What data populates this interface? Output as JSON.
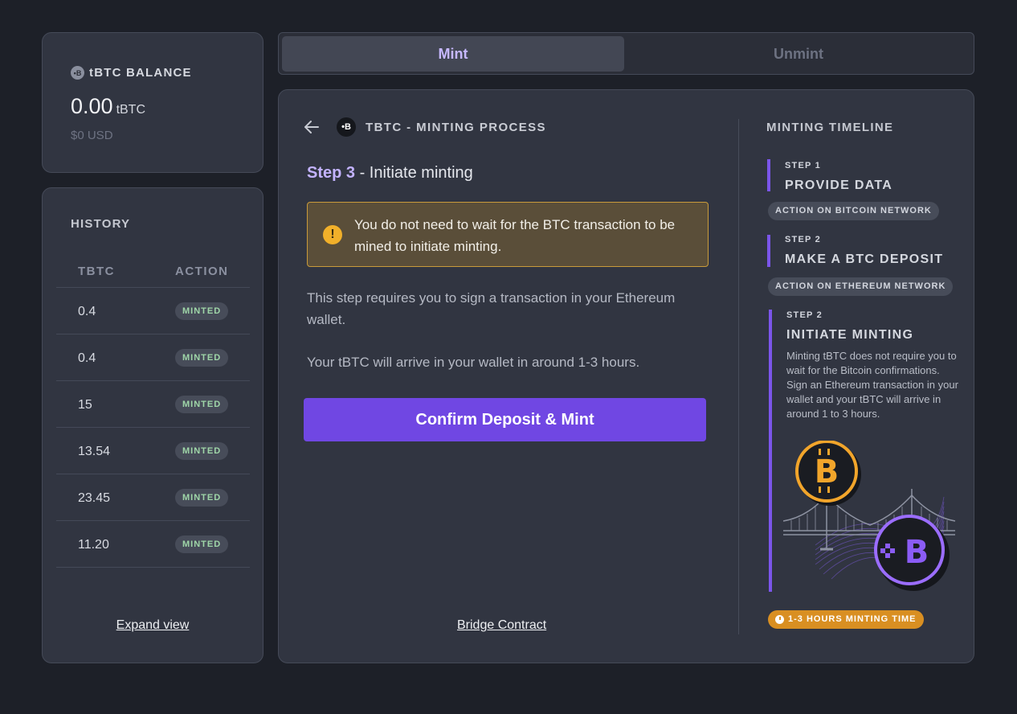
{
  "balance": {
    "title": "tBTC BALANCE",
    "badge_glyph": "•B",
    "amount": "0.00",
    "unit": "tBTC",
    "usd": "$0 USD"
  },
  "history": {
    "title": "HISTORY",
    "columns": [
      "TBTC",
      "ACTION"
    ],
    "rows": [
      {
        "amount": "0.4",
        "action": "MINTED"
      },
      {
        "amount": "0.4",
        "action": "MINTED"
      },
      {
        "amount": "15",
        "action": "MINTED"
      },
      {
        "amount": "13.54",
        "action": "MINTED"
      },
      {
        "amount": "23.45",
        "action": "MINTED"
      },
      {
        "amount": "11.20",
        "action": "MINTED"
      }
    ],
    "expand_label": "Expand view"
  },
  "tabs": [
    {
      "label": "Mint",
      "active": true
    },
    {
      "label": "Unmint",
      "active": false
    }
  ],
  "main": {
    "title": "TBTC - MINTING PROCESS",
    "logo_glyph": "•B",
    "step_number": "Step 3",
    "step_title": " - Initiate minting",
    "warning_icon": "!",
    "warning_text": "You do not need to wait for the BTC transaction to be mined to initiate minting.",
    "paragraph_1": "This step requires you to sign a transaction in your Ethereum wallet.",
    "paragraph_2": "Your tBTC will arrive in your wallet in around 1-3 hours.",
    "confirm_label": "Confirm Deposit & Mint",
    "bridge_link": "Bridge Contract"
  },
  "timeline": {
    "title": "MINTING TIMELINE",
    "steps": [
      {
        "label": "STEP 1",
        "title": "PROVIDE DATA",
        "badge": "ACTION ON BITCOIN NETWORK"
      },
      {
        "label": "STEP 2",
        "title": "MAKE A BTC DEPOSIT",
        "badge": "ACTION ON ETHEREUM NETWORK"
      },
      {
        "label": "STEP 2",
        "title": "INITIATE MINTING",
        "description_1": "Minting tBTC does not require you to wait for the Bitcoin confirmations.",
        "description_2": "Sign an Ethereum transaction in your wallet and your tBTC will arrive in around 1 to 3 hours."
      }
    ],
    "time_badge": "1-3 HOURS MINTING TIME"
  },
  "colors": {
    "background": "#1d2028",
    "card": "#313541",
    "accent": "#7047e3",
    "accent_text": "#c3b3ff",
    "warning_bg": "#5a4e39",
    "warning_border": "#c99b3b",
    "minted_text": "#9fd6a8",
    "time_badge": "#d98f22",
    "bitcoin": "#f2a52b"
  },
  "icons": {
    "back": "arrow-left-icon",
    "warning": "exclamation-icon",
    "clock": "clock-icon",
    "bitcoin": "bitcoin-coin-icon",
    "tbtc": "tbtc-coin-icon",
    "bridge": "bridge-illustration"
  }
}
